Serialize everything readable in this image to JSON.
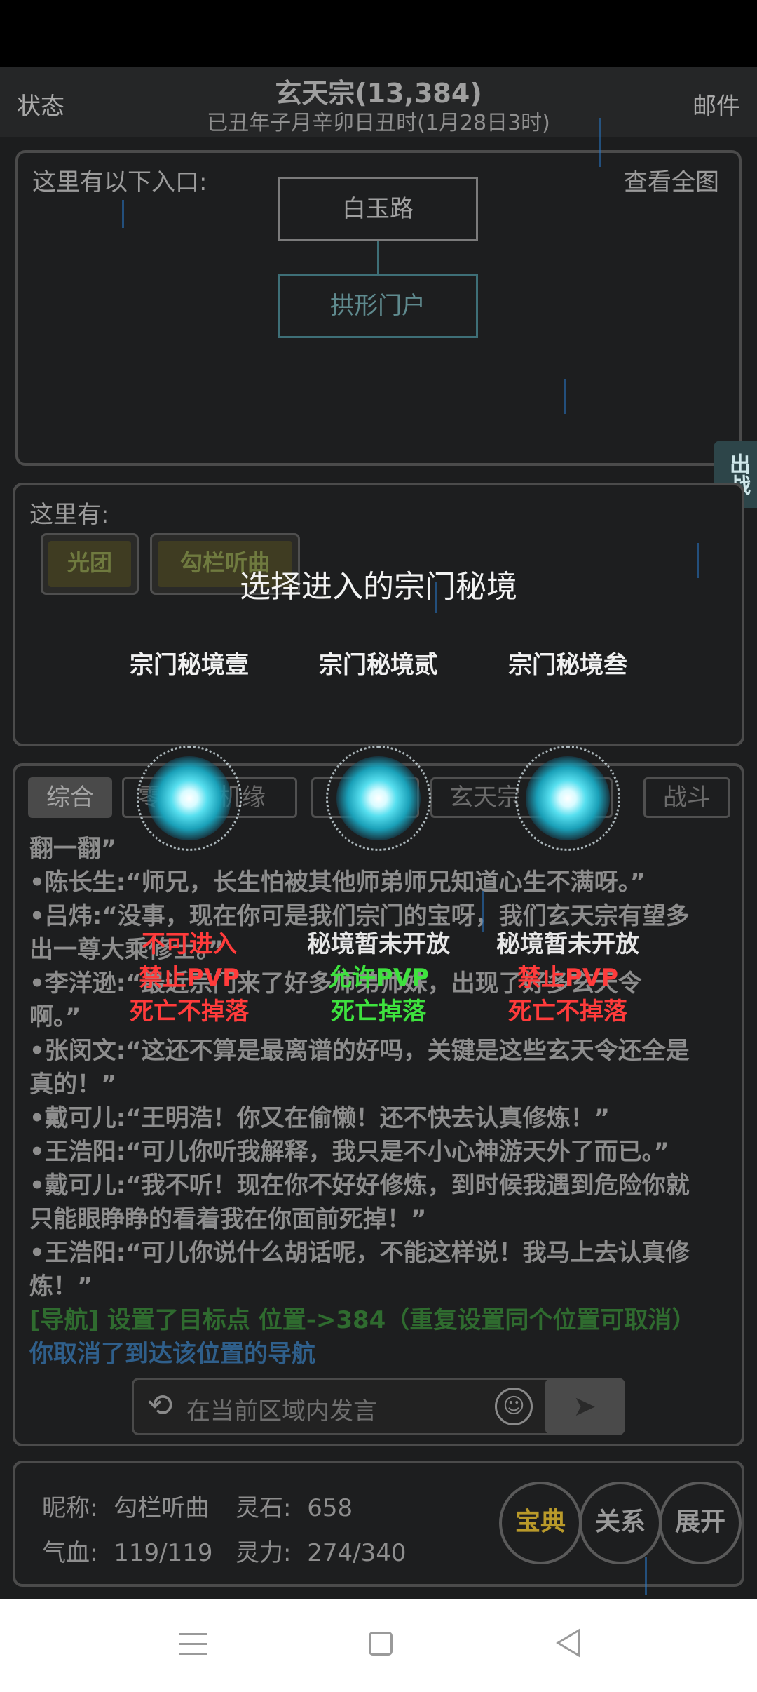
{
  "header": {
    "left_label": "状态",
    "title": "玄天宗(13,384)",
    "subtitle": "已丑年子月辛卯日丑时(1月28日3时)",
    "right_label": "邮件"
  },
  "map_panel": {
    "entrances_label": "这里有以下入口:",
    "view_map_label": "查看全图",
    "nodes": [
      "白玉路",
      "拱形门户"
    ]
  },
  "side_tab": {
    "label": "出战"
  },
  "here_panel": {
    "label": "这里有:",
    "tags": [
      "光团",
      "勾栏听曲"
    ]
  },
  "overlay": {
    "title": "选择进入的宗门秘境",
    "realms": [
      {
        "name": "宗门秘境壹",
        "status": "不可进入",
        "pvp": "禁止PVP",
        "drop": "死亡不掉落"
      },
      {
        "name": "宗门秘境贰",
        "status": "秘境暂未开放",
        "pvp": "允许PVP",
        "drop": "死亡掉落"
      },
      {
        "name": "宗门秘境叁",
        "status": "秘境暂未开放",
        "pvp": "禁止PVP",
        "drop": "死亡不掉落"
      }
    ]
  },
  "chat": {
    "tabs": [
      "综合",
      "零",
      "机缘",
      "",
      "玄天宗",
      "战斗"
    ],
    "lines": [
      "翻一翻”",
      "•陈长生:“师兄，长生怕被其他师弟师兄知道心生不满呀。”",
      "•吕炜:“没事，现在你可是我们宗门的宝呀，我们玄天宗有望多",
      "出一尊大乘修士。”",
      "•李洋逊:“最近宗门来了好多师弟师妹，出现了好多玄天令",
      "啊。”",
      "•张闵文:“这还不算是最离谱的好吗，关键是这些玄天令还全是",
      "真的！”",
      "•戴可儿:“王明浩！你又在偷懒！还不快去认真修炼！”",
      "•王浩阳:“可儿你听我解释，我只是不小心神游天外了而已。”",
      "•戴可儿:“我不听！现在你不好好修炼，到时候我遇到危险你就",
      "只能眼睁睁的看着我在你面前死掉！”",
      "•王浩阳:“可儿你说什么胡话呢，不能这样说！我马上去认真修",
      "炼！”"
    ],
    "nav_line": "[导航] 设置了目标点 位置->384（重复设置同个位置可取消）",
    "cancel_line": "你取消了到达该位置的导航",
    "input_placeholder": "在当前区域内发言"
  },
  "player": {
    "nickname_label": "昵称:",
    "nickname": "勾栏听曲",
    "stone_label": "灵石:",
    "stone": "658",
    "hp_label": "气血:",
    "hp": "119/119",
    "mp_label": "灵力:",
    "mp": "274/340"
  },
  "buttons": {
    "codex": "宝典",
    "relations": "关系",
    "expand": "展开"
  },
  "colors": {
    "accent_gold": "#b99a2a",
    "forbid_red": "#ff3b3b",
    "allow_green": "#3ee23e",
    "teal": "#3e6f77"
  }
}
